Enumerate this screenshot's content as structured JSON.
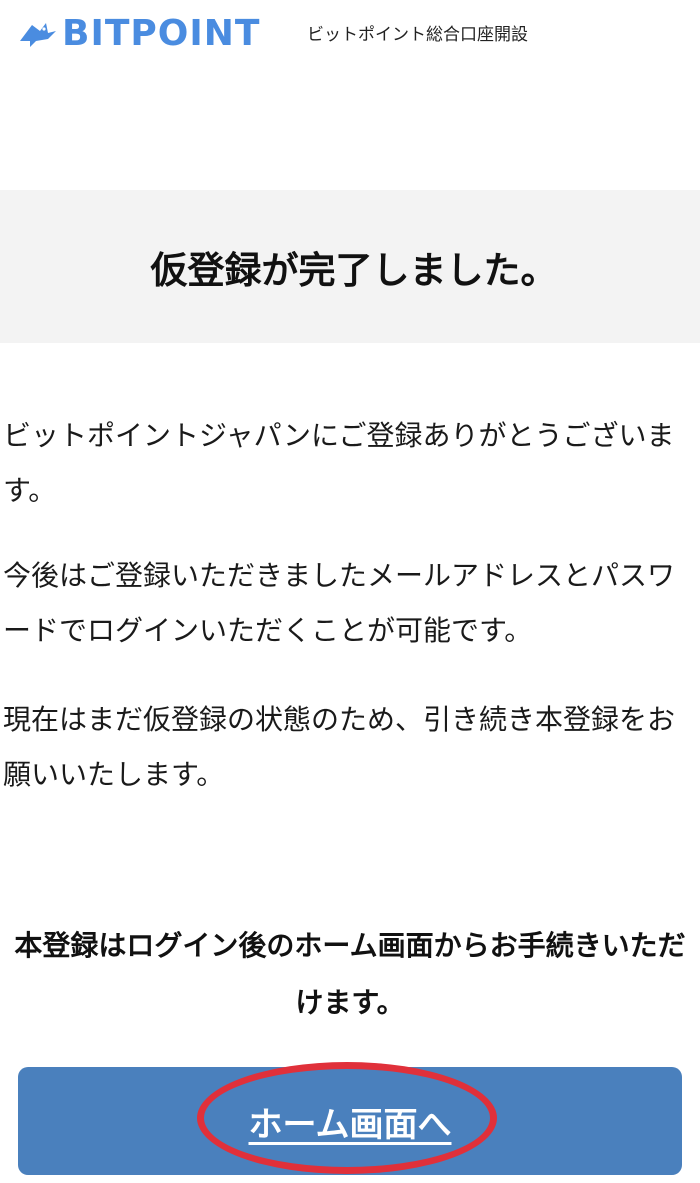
{
  "header": {
    "logo_text": "BITPOINT",
    "title": "ビットポイント総合口座開設",
    "brand_color": "#4a8ce0"
  },
  "banner": {
    "title": "仮登録が完了しました。"
  },
  "body": {
    "paragraph1": "ビットポイントジャパンにご登録ありがとうございます。",
    "paragraph2": "今後はご登録いただきましたメールアドレスとパスワードでログインいただくことが可能です。",
    "paragraph3": "現在はまだ仮登録の状態のため、引き続き本登録をお願いいたします。"
  },
  "notice": {
    "text": "本登録はログイン後のホーム画面からお手続きいただけます。"
  },
  "home_button": {
    "label": "ホーム画面へ",
    "color": "#4a80bd"
  },
  "annotation": {
    "color": "#e0303a"
  }
}
